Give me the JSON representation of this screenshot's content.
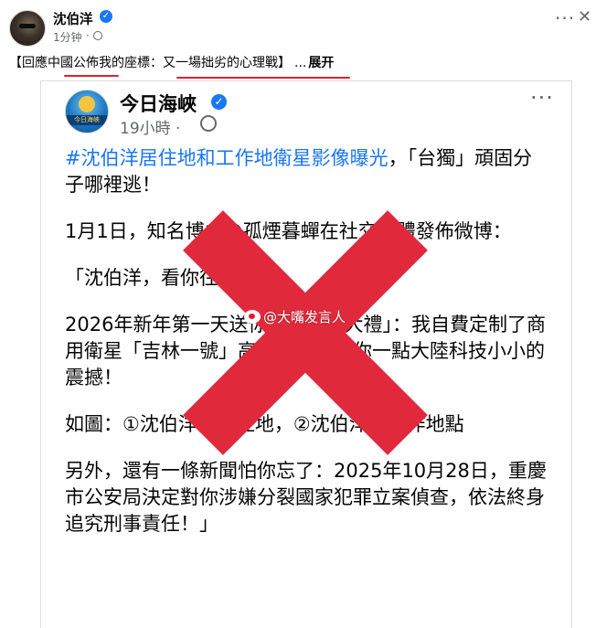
{
  "post": {
    "author_name": "沈伯洋",
    "verified_glyph": "✓",
    "time": "1分钟",
    "dot": "·",
    "more_glyph": "···",
    "close_glyph": "✕",
    "caption": "【回應中國公佈我的座標：又一場拙劣的心理戰】",
    "ellipsis": "...",
    "expand_label": "展开"
  },
  "shared_post": {
    "channel_name": "今日海峽",
    "time": "19小時 ·",
    "more_glyph": "···",
    "logo_text": "今日海峽",
    "hashtag": "#沈伯洋居住地和工作地衛星影像曝光",
    "line1_rest": "，「台獨」頑固分子哪裡逃！",
    "para2": "1月1日，知名博主@孤煙暮蟬在社交媒體發佈微博：",
    "para3": "「沈伯洋，看你往哪逃！",
    "para4": "2026年新年第一天送你一份新年大禮」：我自費定制了商用衛星「吉林一號」高清影像，給你一點大陸科技小小的震撼！",
    "para5": "如圖：①沈伯洋的居住地，②沈伯洋的工作地點",
    "para6": "另外，還有一條新聞怕你忘了：2025年10月28日，重慶市公安局決定對你涉嫌分裂國家犯罪立案偵查，依法終身追究刑事責任！」"
  },
  "watermark": "@大嘴发言人",
  "colors": {
    "overlay_x": "#e02a3b",
    "link_blue": "#1877f2",
    "underline_red": "#d8242c"
  }
}
